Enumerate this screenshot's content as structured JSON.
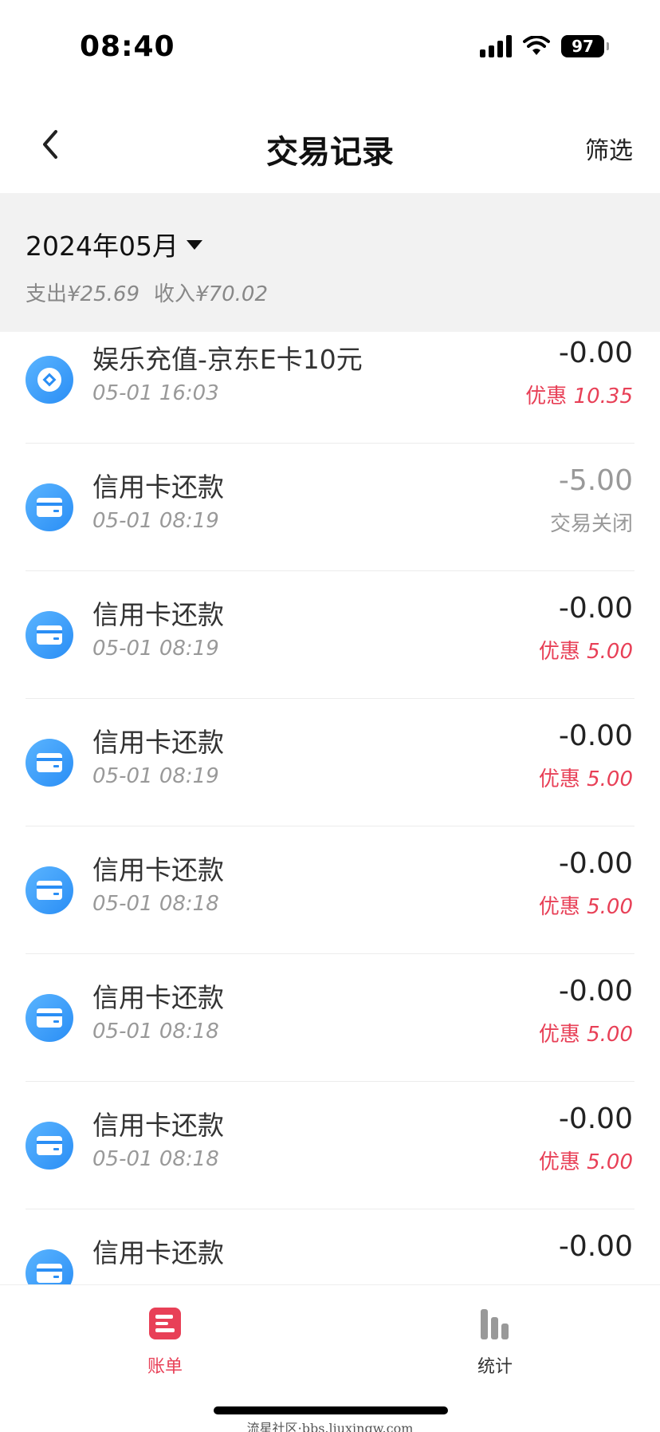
{
  "status_bar": {
    "time": "08:40",
    "battery": "97"
  },
  "nav": {
    "title": "交易记录",
    "filter_label": "筛选"
  },
  "summary": {
    "month": "2024年05月",
    "expense_label": "支出",
    "expense_value": "¥25.69",
    "income_label": "收入",
    "income_value": "¥70.02"
  },
  "transactions": [
    {
      "icon": "coin-icon",
      "title": "娱乐充值-京东E卡10元",
      "time": "05-01 16:03",
      "amount": "-0.00",
      "sub_label": "优惠",
      "sub_value": "10.35",
      "status": "discount"
    },
    {
      "icon": "credit-card-icon",
      "title": "信用卡还款",
      "time": "05-01 08:19",
      "amount": "-5.00",
      "sub_label": "交易关闭",
      "sub_value": "",
      "status": "closed"
    },
    {
      "icon": "credit-card-icon",
      "title": "信用卡还款",
      "time": "05-01 08:19",
      "amount": "-0.00",
      "sub_label": "优惠",
      "sub_value": "5.00",
      "status": "discount"
    },
    {
      "icon": "credit-card-icon",
      "title": "信用卡还款",
      "time": "05-01 08:19",
      "amount": "-0.00",
      "sub_label": "优惠",
      "sub_value": "5.00",
      "status": "discount"
    },
    {
      "icon": "credit-card-icon",
      "title": "信用卡还款",
      "time": "05-01 08:18",
      "amount": "-0.00",
      "sub_label": "优惠",
      "sub_value": "5.00",
      "status": "discount"
    },
    {
      "icon": "credit-card-icon",
      "title": "信用卡还款",
      "time": "05-01 08:18",
      "amount": "-0.00",
      "sub_label": "优惠",
      "sub_value": "5.00",
      "status": "discount"
    },
    {
      "icon": "credit-card-icon",
      "title": "信用卡还款",
      "time": "05-01 08:18",
      "amount": "-0.00",
      "sub_label": "优惠",
      "sub_value": "5.00",
      "status": "discount"
    },
    {
      "icon": "credit-card-icon",
      "title": "信用卡还款",
      "time": "",
      "amount": "-0.00",
      "sub_label": "",
      "sub_value": "",
      "status": "discount"
    }
  ],
  "tabs": [
    {
      "label": "账单",
      "icon": "bill-icon",
      "active": true
    },
    {
      "label": "统计",
      "icon": "stats-bar-icon",
      "active": false
    }
  ],
  "watermark": "流星社区·bbs.liuxingw.com",
  "colors": {
    "accent_red": "#e84057",
    "icon_blue": "#2a8ef5",
    "summary_bg": "#f2f2f2"
  }
}
